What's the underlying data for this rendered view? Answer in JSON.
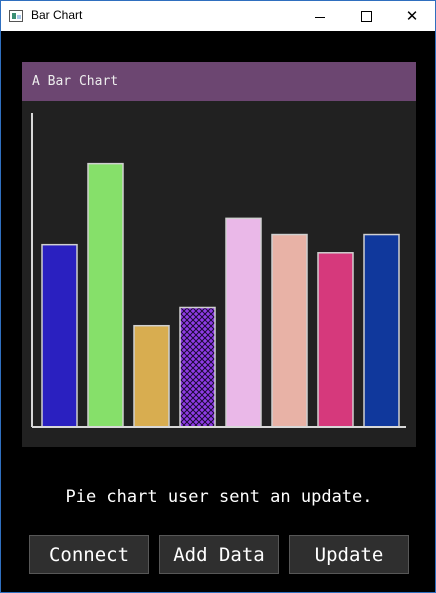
{
  "window": {
    "title": "Bar Chart"
  },
  "chart_data": {
    "type": "bar",
    "title": "A Bar Chart",
    "categories": [
      "",
      "",
      "",
      "",
      "",
      "",
      "",
      ""
    ],
    "values": [
      180,
      260,
      100,
      118,
      206,
      190,
      172,
      190
    ],
    "ylim": [
      0,
      310
    ],
    "colors": [
      "#2a20c0",
      "#86e06a",
      "#d8ad50",
      "#8f3be6",
      "#eab8e8",
      "#e8b2a6",
      "#d6397c",
      "#10389c"
    ],
    "hatched": [
      false,
      false,
      false,
      true,
      false,
      false,
      false,
      false
    ],
    "axes_color": "#d8d8d8"
  },
  "status": {
    "text": "Pie chart user sent an update."
  },
  "buttons": {
    "connect": "Connect",
    "add_data": "Add Data",
    "update": "Update"
  }
}
